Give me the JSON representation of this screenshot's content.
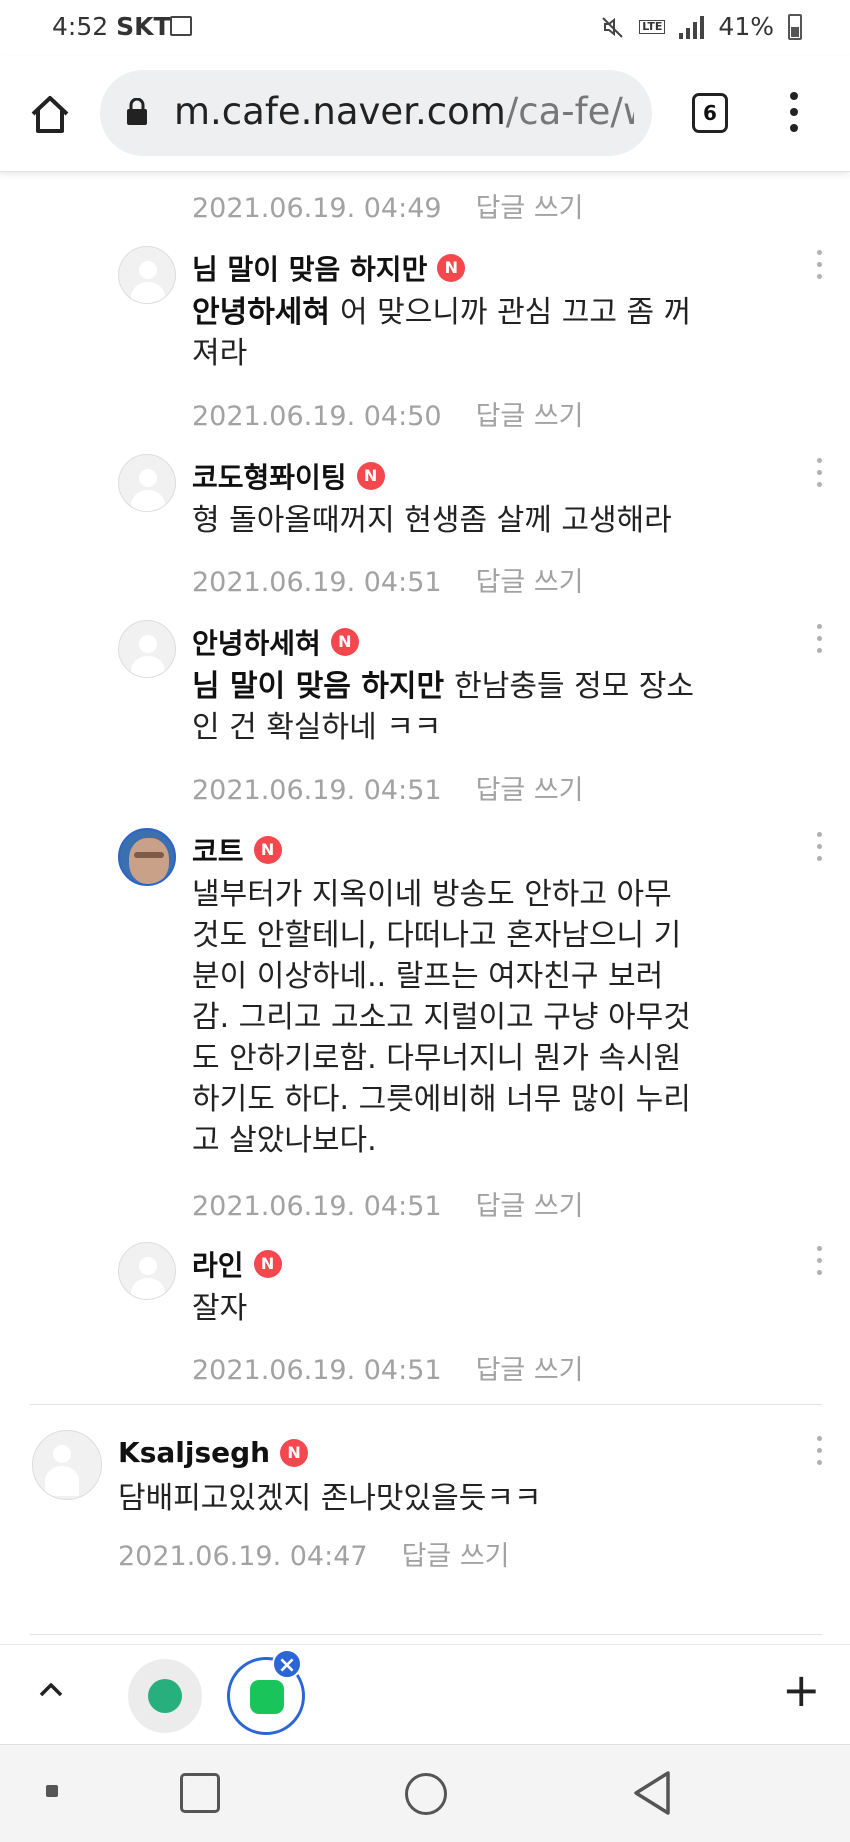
{
  "status_bar": {
    "time": "4:52",
    "carrier": "SKT",
    "network": "LTE",
    "battery": "41%"
  },
  "browser": {
    "url_host": "m.cafe.naver.com",
    "url_path": "/ca-fe/web",
    "tab_count": "6"
  },
  "comments": [
    {
      "nickname": "님 말이 맞음 하지만",
      "badge": "N",
      "mention": "안녕하세혀",
      "text_line1": "어 맞으니까 관심 끄고 좀 꺼",
      "text_line2": "져라",
      "date": "2021.06.19. 04:50",
      "reply": "답글 쓰기"
    },
    {
      "nickname": "코도형퐈이팅",
      "badge": "N",
      "text_line1": "형 돌아올때꺼지 현생좀 살께 고생해라",
      "date": "2021.06.19. 04:51",
      "reply": "답글 쓰기"
    },
    {
      "nickname": "안녕하세혀",
      "badge": "N",
      "mention": "님 말이 맞음 하지만",
      "text_line1": "한남충들 정모 장소",
      "text_line2": "인 건 확실하네 ㅋㅋ",
      "date": "2021.06.19. 04:51",
      "reply": "답글 쓰기"
    },
    {
      "nickname": "코트",
      "badge": "N",
      "lines": [
        "낼부터가 지옥이네 방송도 안하고 아무",
        "것도 안할테니, 다떠나고 혼자남으니 기",
        "분이 이상하네.. 랄프는 여자친구 보러",
        "감. 그리고 고소고 지럴이고 구냥 아무것",
        "도 안하기로함. 다무너지니 뭔가 속시원",
        "하기도 하다. 그릇에비해 너무 많이 누리",
        "고 살았나보다."
      ],
      "date": "2021.06.19. 04:51",
      "reply": "답글 쓰기"
    },
    {
      "nickname": "라인",
      "badge": "N",
      "text_line1": "잘자",
      "date": "2021.06.19. 04:51",
      "reply": "답글 쓰기"
    },
    {
      "nickname": "Ksaljsegh",
      "badge": "N",
      "text_line1": "담배피고있겠지 존나맛있을듯ㅋㅋ",
      "date": "2021.06.19. 04:47",
      "reply": "답글 쓰기"
    }
  ],
  "partial_top": {
    "date": "2021.06.19. 04:49",
    "reply": "답글 쓰기"
  },
  "toolbar": {
    "plus": "+",
    "close": "×"
  },
  "colors": {
    "badge": "#f5474e",
    "meta_text": "#a2a2a2",
    "active_blue": "#2b66d6",
    "cafe_green": "#19c55a"
  }
}
